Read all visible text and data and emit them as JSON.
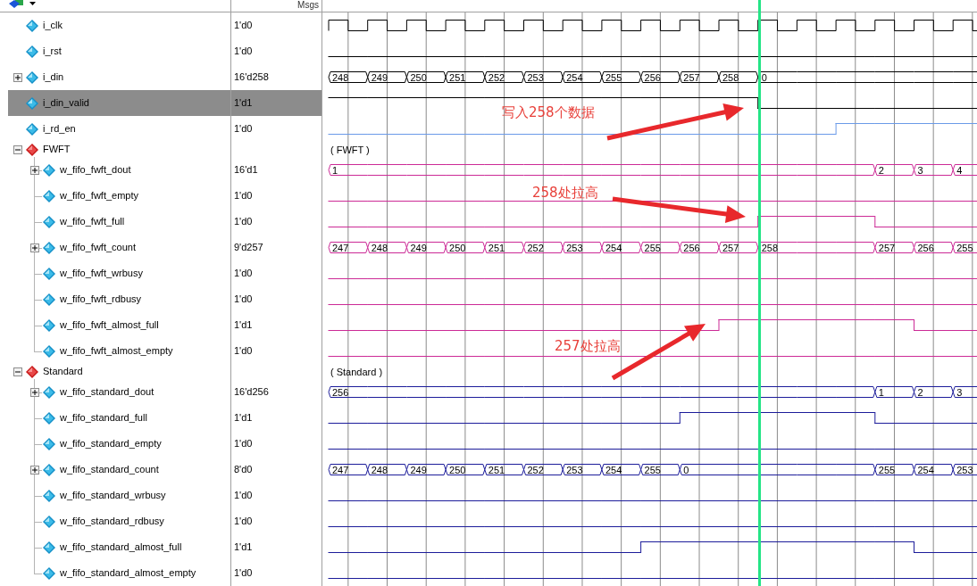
{
  "header": {
    "value_column": "Msgs"
  },
  "signals": [
    {
      "kind": "clock",
      "name": "i_clk",
      "value": "1'd0",
      "color": "#000000",
      "selected": false
    },
    {
      "kind": "bit",
      "name": "i_rst",
      "value": "1'd0",
      "color": "#000000",
      "selected": false,
      "high": [
        false,
        false,
        false,
        false,
        false,
        false,
        false,
        false,
        false,
        false,
        false,
        false,
        false,
        false,
        false,
        false,
        false
      ]
    },
    {
      "kind": "bus",
      "name": "i_din",
      "value": "16'd258",
      "color": "#000000",
      "selected": false,
      "expanded": false,
      "cycles": [
        {
          "change": true,
          "label": "248"
        },
        {
          "change": true,
          "label": "249"
        },
        {
          "change": true,
          "label": "250"
        },
        {
          "change": true,
          "label": "251"
        },
        {
          "change": true,
          "label": "252"
        },
        {
          "change": true,
          "label": "253"
        },
        {
          "change": true,
          "label": "254"
        },
        {
          "change": true,
          "label": "255"
        },
        {
          "change": true,
          "label": "256"
        },
        {
          "change": true,
          "label": "257"
        },
        {
          "change": true,
          "label": "258"
        },
        {
          "change": true,
          "label": "0"
        },
        {
          "change": false
        },
        {
          "change": false
        },
        {
          "change": false
        },
        {
          "change": false
        },
        {
          "change": false
        }
      ]
    },
    {
      "kind": "bit",
      "name": "i_din_valid",
      "value": "1'd1",
      "color": "#000000",
      "selected": true,
      "high": [
        true,
        true,
        true,
        true,
        true,
        true,
        true,
        true,
        true,
        true,
        true,
        false,
        false,
        false,
        false,
        false,
        false
      ]
    },
    {
      "kind": "bit",
      "name": "i_rd_en",
      "value": "1'd0",
      "color": "#6a9ae8",
      "selected": false,
      "high": [
        false,
        false,
        false,
        false,
        false,
        false,
        false,
        false,
        false,
        false,
        false,
        false,
        false,
        true,
        true,
        true,
        true
      ]
    },
    {
      "kind": "group",
      "name": "FWFT",
      "wave_label": "( FWFT )",
      "expanded": true,
      "selected": false,
      "children": [
        {
          "kind": "bus",
          "name": "w_fifo_fwft_dout",
          "value": "16'd1",
          "color": "#cc2a96",
          "selected": false,
          "expanded": false,
          "cycles": [
            {
              "change": true,
              "label": "1"
            },
            {
              "change": false
            },
            {
              "change": false
            },
            {
              "change": false
            },
            {
              "change": false
            },
            {
              "change": false
            },
            {
              "change": false
            },
            {
              "change": false
            },
            {
              "change": false
            },
            {
              "change": false
            },
            {
              "change": false
            },
            {
              "change": false
            },
            {
              "change": false
            },
            {
              "change": false
            },
            {
              "change": true,
              "label": "2"
            },
            {
              "change": true,
              "label": "3"
            },
            {
              "change": true,
              "label": "4"
            }
          ]
        },
        {
          "kind": "bit",
          "name": "w_fifo_fwft_empty",
          "value": "1'd0",
          "color": "#cc2a96",
          "selected": false,
          "high": [
            false,
            false,
            false,
            false,
            false,
            false,
            false,
            false,
            false,
            false,
            false,
            false,
            false,
            false,
            false,
            false,
            false
          ]
        },
        {
          "kind": "bit",
          "name": "w_fifo_fwft_full",
          "value": "1'd0",
          "color": "#cc2a96",
          "selected": false,
          "high": [
            false,
            false,
            false,
            false,
            false,
            false,
            false,
            false,
            false,
            false,
            false,
            true,
            true,
            true,
            false,
            false,
            false
          ]
        },
        {
          "kind": "bus",
          "name": "w_fifo_fwft_count",
          "value": "9'd257",
          "color": "#cc2a96",
          "selected": false,
          "expanded": false,
          "cycles": [
            {
              "change": true,
              "label": "247"
            },
            {
              "change": true,
              "label": "248"
            },
            {
              "change": true,
              "label": "249"
            },
            {
              "change": true,
              "label": "250"
            },
            {
              "change": true,
              "label": "251"
            },
            {
              "change": true,
              "label": "252"
            },
            {
              "change": true,
              "label": "253"
            },
            {
              "change": true,
              "label": "254"
            },
            {
              "change": true,
              "label": "255"
            },
            {
              "change": true,
              "label": "256"
            },
            {
              "change": true,
              "label": "257"
            },
            {
              "change": true,
              "label": "258"
            },
            {
              "change": false
            },
            {
              "change": false
            },
            {
              "change": true,
              "label": "257"
            },
            {
              "change": true,
              "label": "256"
            },
            {
              "change": true,
              "label": "255"
            }
          ]
        },
        {
          "kind": "bit",
          "name": "w_fifo_fwft_wrbusy",
          "value": "1'd0",
          "color": "#cc2a96",
          "selected": false,
          "high": [
            false,
            false,
            false,
            false,
            false,
            false,
            false,
            false,
            false,
            false,
            false,
            false,
            false,
            false,
            false,
            false,
            false
          ]
        },
        {
          "kind": "bit",
          "name": "w_fifo_fwft_rdbusy",
          "value": "1'd0",
          "color": "#cc2a96",
          "selected": false,
          "high": [
            false,
            false,
            false,
            false,
            false,
            false,
            false,
            false,
            false,
            false,
            false,
            false,
            false,
            false,
            false,
            false,
            false
          ]
        },
        {
          "kind": "bit",
          "name": "w_fifo_fwft_almost_full",
          "value": "1'd1",
          "color": "#cc2a96",
          "selected": false,
          "high": [
            false,
            false,
            false,
            false,
            false,
            false,
            false,
            false,
            false,
            false,
            true,
            true,
            true,
            true,
            true,
            false,
            false
          ]
        },
        {
          "kind": "bit",
          "name": "w_fifo_fwft_almost_empty",
          "value": "1'd0",
          "color": "#cc2a96",
          "selected": false,
          "high": [
            false,
            false,
            false,
            false,
            false,
            false,
            false,
            false,
            false,
            false,
            false,
            false,
            false,
            false,
            false,
            false,
            false
          ]
        }
      ]
    },
    {
      "kind": "group",
      "name": "Standard",
      "wave_label": "( Standard )",
      "expanded": true,
      "selected": false,
      "children": [
        {
          "kind": "bus",
          "name": "w_fifo_standard_dout",
          "value": "16'd256",
          "color": "#1c1c9a",
          "selected": false,
          "expanded": false,
          "cycles": [
            {
              "change": true,
              "label": "256"
            },
            {
              "change": false
            },
            {
              "change": false
            },
            {
              "change": false
            },
            {
              "change": false
            },
            {
              "change": false
            },
            {
              "change": false
            },
            {
              "change": false
            },
            {
              "change": false
            },
            {
              "change": false
            },
            {
              "change": false
            },
            {
              "change": false
            },
            {
              "change": false
            },
            {
              "change": false
            },
            {
              "change": true,
              "label": "1"
            },
            {
              "change": true,
              "label": "2"
            },
            {
              "change": true,
              "label": "3"
            }
          ]
        },
        {
          "kind": "bit",
          "name": "w_fifo_standard_full",
          "value": "1'd1",
          "color": "#1c1c9a",
          "selected": false,
          "high": [
            false,
            false,
            false,
            false,
            false,
            false,
            false,
            false,
            false,
            true,
            true,
            true,
            true,
            true,
            false,
            false,
            false
          ]
        },
        {
          "kind": "bit",
          "name": "w_fifo_standard_empty",
          "value": "1'd0",
          "color": "#1c1c9a",
          "selected": false,
          "high": [
            false,
            false,
            false,
            false,
            false,
            false,
            false,
            false,
            false,
            false,
            false,
            false,
            false,
            false,
            false,
            false,
            false
          ]
        },
        {
          "kind": "bus",
          "name": "w_fifo_standard_count",
          "value": "8'd0",
          "color": "#1c1c9a",
          "selected": false,
          "expanded": false,
          "cycles": [
            {
              "change": true,
              "label": "247"
            },
            {
              "change": true,
              "label": "248"
            },
            {
              "change": true,
              "label": "249"
            },
            {
              "change": true,
              "label": "250"
            },
            {
              "change": true,
              "label": "251"
            },
            {
              "change": true,
              "label": "252"
            },
            {
              "change": true,
              "label": "253"
            },
            {
              "change": true,
              "label": "254"
            },
            {
              "change": true,
              "label": "255"
            },
            {
              "change": true,
              "label": "0"
            },
            {
              "change": false
            },
            {
              "change": false
            },
            {
              "change": false
            },
            {
              "change": false
            },
            {
              "change": true,
              "label": "255"
            },
            {
              "change": true,
              "label": "254"
            },
            {
              "change": true,
              "label": "253"
            }
          ]
        },
        {
          "kind": "bit",
          "name": "w_fifo_standard_wrbusy",
          "value": "1'd0",
          "color": "#1c1c9a",
          "selected": false,
          "high": [
            false,
            false,
            false,
            false,
            false,
            false,
            false,
            false,
            false,
            false,
            false,
            false,
            false,
            false,
            false,
            false,
            false
          ]
        },
        {
          "kind": "bit",
          "name": "w_fifo_standard_rdbusy",
          "value": "1'd0",
          "color": "#1c1c9a",
          "selected": false,
          "high": [
            false,
            false,
            false,
            false,
            false,
            false,
            false,
            false,
            false,
            false,
            false,
            false,
            false,
            false,
            false,
            false,
            false
          ]
        },
        {
          "kind": "bit",
          "name": "w_fifo_standard_almost_full",
          "value": "1'd1",
          "color": "#1c1c9a",
          "selected": false,
          "high": [
            false,
            false,
            false,
            false,
            false,
            false,
            false,
            false,
            true,
            true,
            true,
            true,
            true,
            true,
            true,
            false,
            false
          ]
        },
        {
          "kind": "bit",
          "name": "w_fifo_standard_almost_empty",
          "value": "1'd0",
          "color": "#1c1c9a",
          "selected": false,
          "high": [
            false,
            false,
            false,
            false,
            false,
            false,
            false,
            false,
            false,
            false,
            false,
            false,
            false,
            false,
            false,
            false,
            false
          ]
        }
      ]
    }
  ],
  "annotations": [
    {
      "text": "写入258个数据"
    },
    {
      "text": "258处拉高"
    },
    {
      "text": "257处拉高"
    }
  ]
}
